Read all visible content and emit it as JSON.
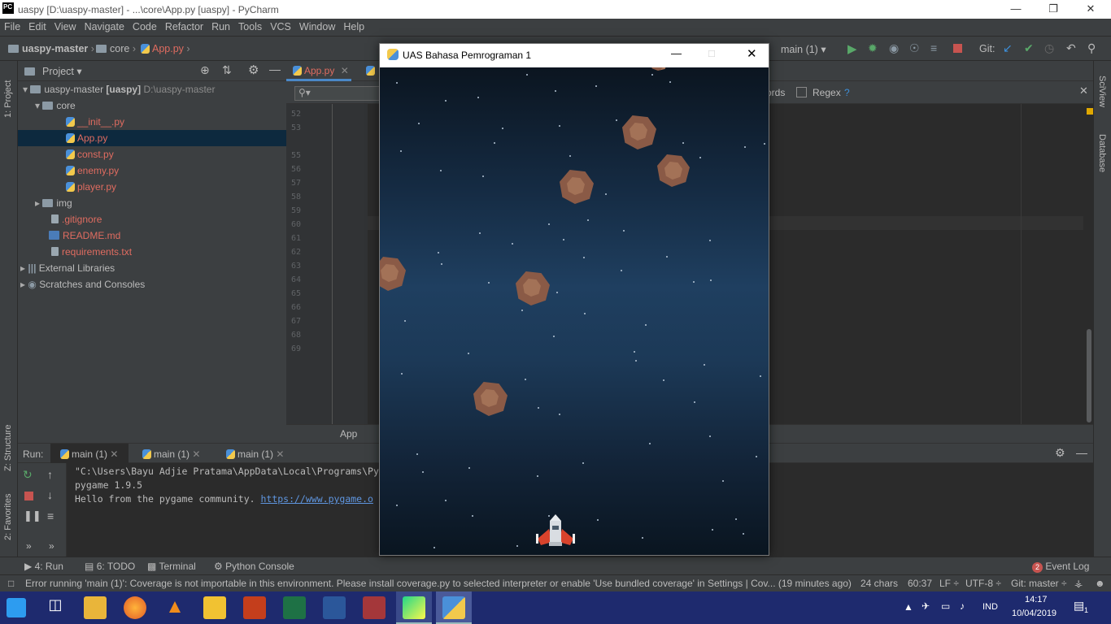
{
  "window": {
    "title": "uaspy [D:\\uaspy-master] - ...\\core\\App.py [uaspy] - PyCharm",
    "logo_text": "PC"
  },
  "menu": [
    "File",
    "Edit",
    "View",
    "Navigate",
    "Code",
    "Refactor",
    "Run",
    "Tools",
    "VCS",
    "Window",
    "Help"
  ],
  "navbar": {
    "project": "uaspy-master",
    "folder": "core",
    "file": "App.py",
    "run_config": "main (1)",
    "git_label": "Git:"
  },
  "project_panel": {
    "title": "Project",
    "root_name": "uaspy-master",
    "root_bold": "[uaspy]",
    "root_path": "D:\\uaspy-master",
    "items": [
      {
        "label": "core"
      },
      {
        "label": "__init__.py"
      },
      {
        "label": "App.py"
      },
      {
        "label": "const.py"
      },
      {
        "label": "enemy.py"
      },
      {
        "label": "player.py"
      },
      {
        "label": "img"
      },
      {
        "label": ".gitignore"
      },
      {
        "label": "README.md"
      },
      {
        "label": "requirements.txt"
      },
      {
        "label": "External Libraries"
      },
      {
        "label": "Scratches and Consoles"
      }
    ]
  },
  "left_stripe": {
    "project": "1: Project",
    "structure": "Z: Structure",
    "favorites": "2: Favorites"
  },
  "right_stripe": {
    "sciview": "SciView",
    "database": "Database"
  },
  "editor": {
    "tab1": "App.py",
    "search": {
      "words": "ords",
      "regex": "Regex",
      "help": "?"
    },
    "line_numbers": [
      "52",
      "53",
      "55",
      "56",
      "57",
      "58",
      "59",
      "60",
      "61",
      "62",
      "63",
      "64",
      "65",
      "66",
      "67",
      "68",
      "69"
    ],
    "breadcrumb": "App"
  },
  "run_panel": {
    "label": "Run:",
    "tabs": [
      "main (1)",
      "main (1)",
      "main (1)"
    ],
    "console": [
      "\"C:\\Users\\Bayu Adjie Pratama\\AppData\\Local\\Programs\\Py",
      "pygame 1.9.5",
      "Hello from the pygame community. "
    ],
    "link": "https://www.pygame.o"
  },
  "bottom_tabs": {
    "run": "4: Run",
    "todo": "6: TODO",
    "terminal": "Terminal",
    "python_console": "Python Console",
    "event_log": "Event Log",
    "event_count": "2"
  },
  "status": {
    "message": "Error running 'main (1)': Coverage is not importable in this environment. Please install coverage.py to selected interpreter or enable 'Use bundled coverage' in Settings | Cov... (19 minutes ago)",
    "chars": "24 chars",
    "position": "60:37",
    "line_sep": "LF ÷",
    "encoding": "UTF-8 ÷",
    "git": "Git: master ÷"
  },
  "pygame_window": {
    "title": "UAS Bahasa Pemrograman 1"
  },
  "taskbar": {
    "lang": "IND",
    "time": "14:17",
    "date": "10/04/2019",
    "notif": "1"
  }
}
